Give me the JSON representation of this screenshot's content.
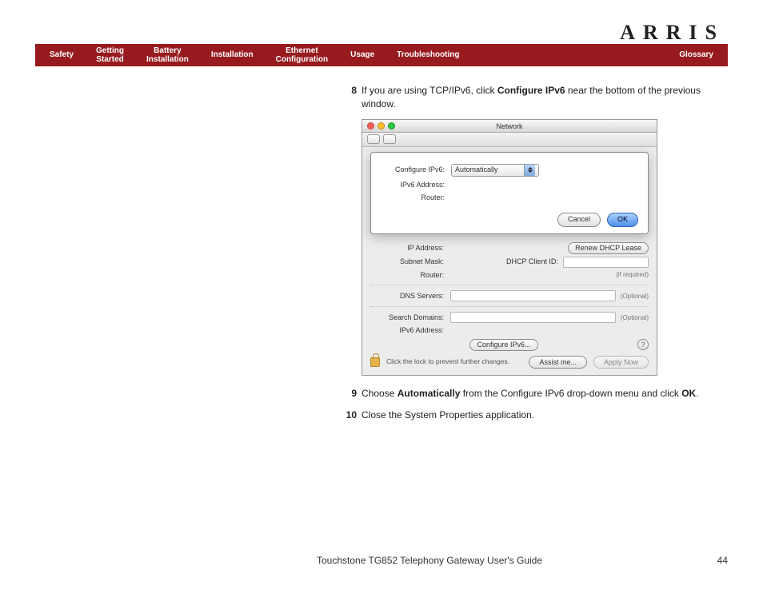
{
  "brand": "ARRIS",
  "nav": {
    "safety": "Safety",
    "getting_started_l1": "Getting",
    "getting_started_l2": "Started",
    "battery_l1": "Battery",
    "battery_l2": "Installation",
    "installation": "Installation",
    "ethernet_l1": "Ethernet",
    "ethernet_l2": "Configuration",
    "usage": "Usage",
    "troubleshooting": "Troubleshooting",
    "glossary": "Glossary"
  },
  "steps": {
    "s8_num": "8",
    "s8_a": "If you are using TCP/IPv6, click ",
    "s8_b": "Configure IPv6",
    "s8_c": " near the bottom of the previous window.",
    "s9_num": "9",
    "s9_a": "Choose ",
    "s9_b": "Automatically",
    "s9_c": " from the Configure IPv6 drop-down menu and click ",
    "s9_d": "OK",
    "s9_e": ".",
    "s10_num": "10",
    "s10_a": "Close the System Properties application."
  },
  "mac": {
    "title": "Network",
    "sheet": {
      "configure_ipv6_label": "Configure IPv6:",
      "configure_ipv6_value": "Automatically",
      "ipv6_address_label": "IPv6 Address:",
      "router_label": "Router:",
      "cancel": "Cancel",
      "ok": "OK"
    },
    "panel": {
      "ip_address": "IP Address:",
      "subnet_mask": "Subnet Mask:",
      "router": "Router:",
      "dhcp_client_id": "DHCP Client ID:",
      "if_required": "(if required)",
      "dns_servers": "DNS Servers:",
      "search_domains": "Search Domains:",
      "ipv6_address": "IPv6 Address:",
      "optional": "(Optional)",
      "renew": "Renew DHCP Lease",
      "configure_ipv6_btn": "Configure IPv6...",
      "lock_text": "Click the lock to prevent further changes.",
      "assist": "Assist me...",
      "apply": "Apply Now",
      "help": "?"
    }
  },
  "footer": {
    "title": "Touchstone TG852 Telephony Gateway User's Guide",
    "page": "44"
  }
}
